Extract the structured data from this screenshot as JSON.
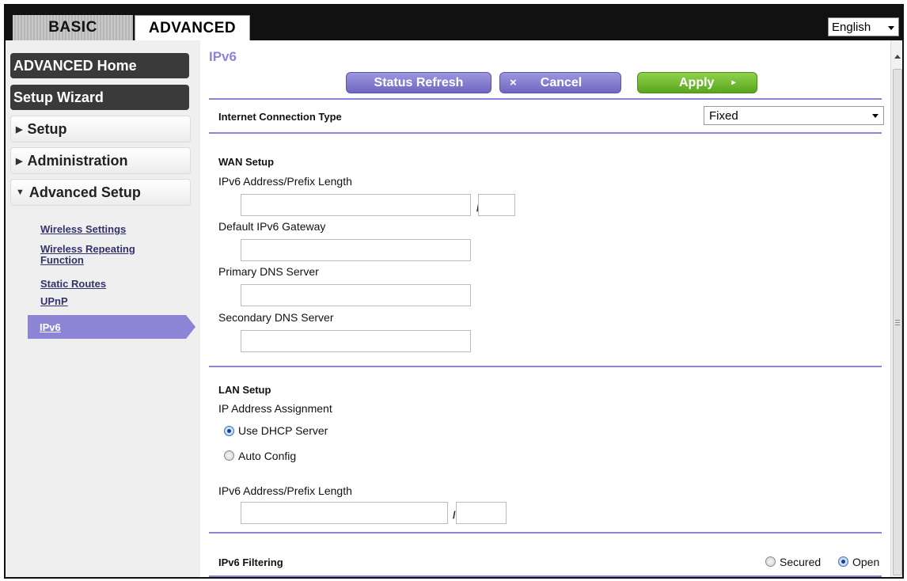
{
  "tabs": {
    "basic": "BASIC",
    "advanced": "ADVANCED"
  },
  "language": {
    "selected": "English"
  },
  "sidebar": {
    "advanced_home": "ADVANCED Home",
    "setup_wizard": "Setup Wizard",
    "setup": "Setup",
    "administration": "Administration",
    "advanced_setup": "Advanced Setup",
    "links": [
      "Wireless Settings",
      "Wireless Repeating",
      "Function",
      "Static Routes",
      "UPnP"
    ],
    "active": "IPv6",
    "collapsed_icon": "triangle-right-icon",
    "expanded_icon": "triangle-down-icon"
  },
  "main": {
    "title": "IPv6",
    "buttons": {
      "status_refresh": "Status Refresh",
      "cancel_x": "×",
      "cancel": "Cancel",
      "apply": "Apply",
      "apply_arrow": "▸"
    },
    "internet_connection_type": {
      "label": "Internet Connection Type",
      "value": "Fixed"
    },
    "wan": {
      "heading": "WAN Setup",
      "address_label": "IPv6 Address/Prefix Length",
      "slash": "/",
      "gateway_label": "Default IPv6 Gateway",
      "primary_dns_label": "Primary DNS Server",
      "secondary_dns_label": "Secondary DNS Server"
    },
    "lan": {
      "heading": "LAN Setup",
      "assignment_label": "IP Address Assignment",
      "option_dhcp": "Use DHCP Server",
      "option_auto": "Auto Config",
      "selected": "Use DHCP Server",
      "address_label": "IPv6 Address/Prefix Length",
      "slash": "/"
    },
    "filtering": {
      "label": "IPv6 Filtering",
      "option_secured": "Secured",
      "option_open": "Open",
      "selected": "Open"
    }
  },
  "colors": {
    "accent": "#8c85d6",
    "apply_green": "#6cb82a",
    "dark_nav": "#3a3a3a"
  }
}
